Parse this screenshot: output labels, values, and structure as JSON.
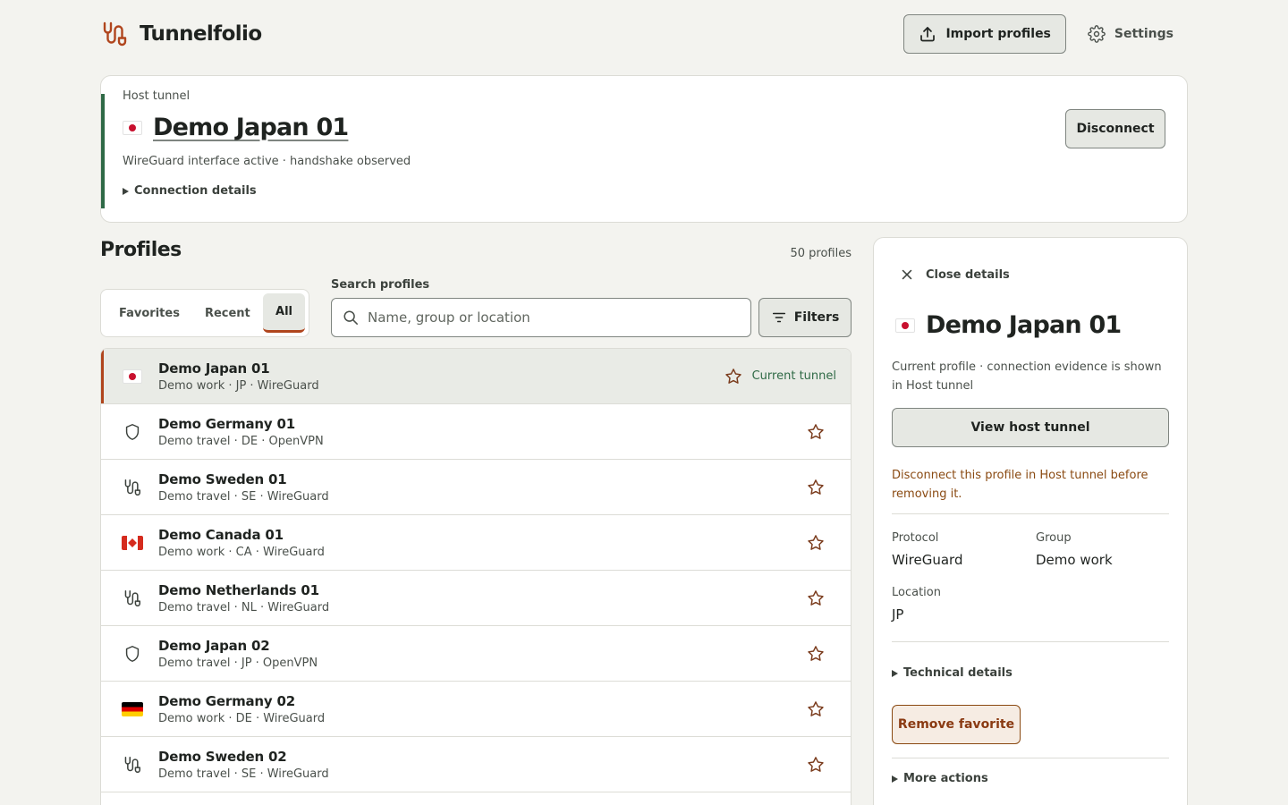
{
  "app": {
    "name": "Tunnelfolio"
  },
  "header": {
    "import_label": "Import profiles",
    "settings_label": "Settings"
  },
  "host": {
    "label": "Host tunnel",
    "title": "Demo Japan 01",
    "status": "WireGuard interface active · handshake observed",
    "details_label": "Connection details",
    "disconnect_label": "Disconnect"
  },
  "profiles": {
    "title": "Profiles",
    "count": "50 profiles",
    "tabs": [
      "Favorites",
      "Recent",
      "All"
    ],
    "active_tab": "All",
    "search_label": "Search profiles",
    "search_placeholder": "Name, group or location",
    "filters_label": "Filters",
    "current_label": "Current tunnel",
    "items": [
      {
        "name": "Demo Japan 01",
        "meta": "Demo work · JP · WireGuard",
        "icon": "flag-jp"
      },
      {
        "name": "Demo Germany 01",
        "meta": "Demo travel · DE · OpenVPN",
        "icon": "shield-icon"
      },
      {
        "name": "Demo Sweden 01",
        "meta": "Demo travel · SE · WireGuard",
        "icon": "tunnel-icon"
      },
      {
        "name": "Demo Canada 01",
        "meta": "Demo work · CA · WireGuard",
        "icon": "flag-ca"
      },
      {
        "name": "Demo Netherlands 01",
        "meta": "Demo travel · NL · WireGuard",
        "icon": "tunnel-icon"
      },
      {
        "name": "Demo Japan 02",
        "meta": "Demo travel · JP · OpenVPN",
        "icon": "shield-icon"
      },
      {
        "name": "Demo Germany 02",
        "meta": "Demo work · DE · WireGuard",
        "icon": "flag-de"
      },
      {
        "name": "Demo Sweden 02",
        "meta": "Demo travel · SE · WireGuard",
        "icon": "tunnel-icon"
      }
    ]
  },
  "panel": {
    "close_label": "Close details",
    "title": "Demo Japan 01",
    "description": "Current profile · connection evidence is shown in Host tunnel",
    "view_label": "View host tunnel",
    "warning": "Disconnect this profile in Host tunnel before removing it.",
    "protocol_label": "Protocol",
    "protocol_value": "WireGuard",
    "group_label": "Group",
    "group_value": "Demo work",
    "location_label": "Location",
    "location_value": "JP",
    "technical_label": "Technical details",
    "remove_label": "Remove favorite",
    "more_label": "More actions"
  },
  "colors": {
    "accent": "#b0451d",
    "success": "#2f6a46",
    "warning": "#8a4a12",
    "background": "#f3f3ef"
  }
}
